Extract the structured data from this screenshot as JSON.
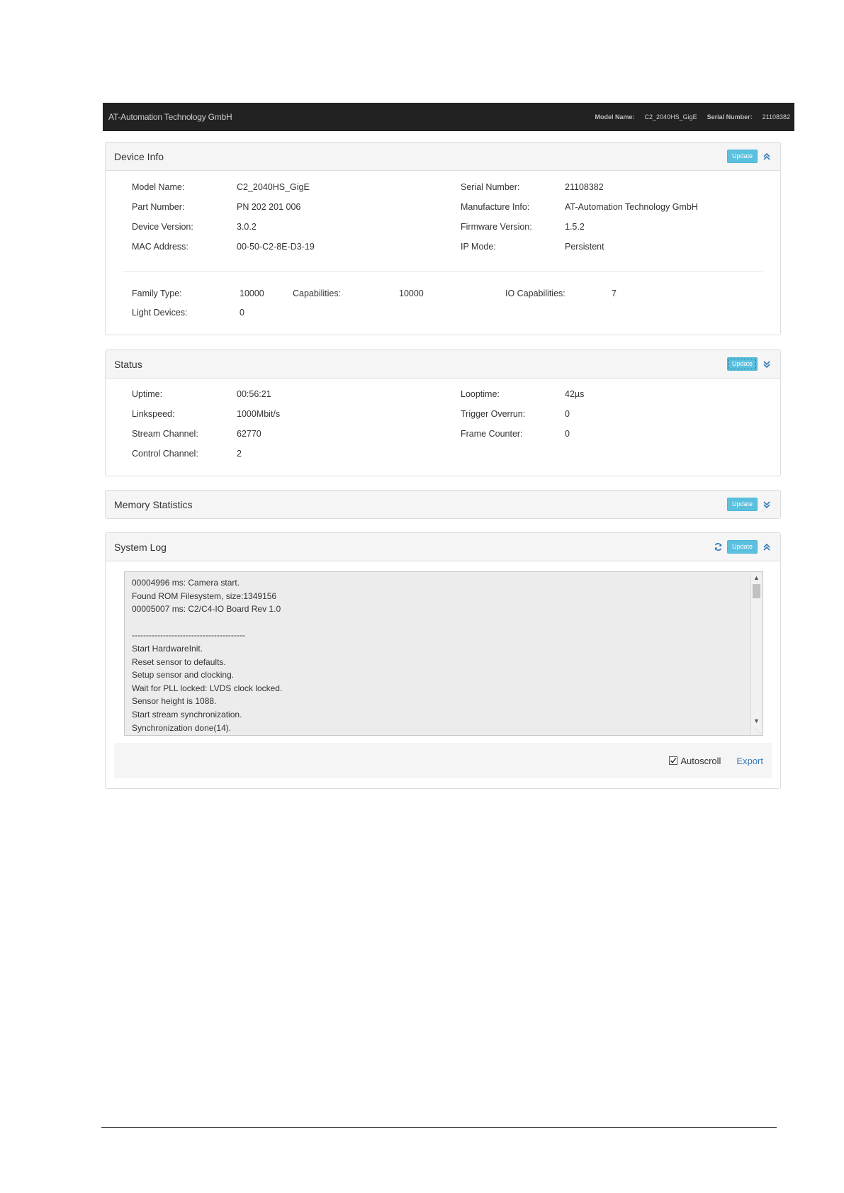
{
  "topbar": {
    "brand": "AT-Automation Technology GmbH",
    "model_label": "Model Name:",
    "model_value": "C2_2040HS_GigE",
    "serial_label": "Serial Number:",
    "serial_value": "21108382"
  },
  "buttons": {
    "update_label": "Update"
  },
  "device_info": {
    "title": "Device Info",
    "left": [
      {
        "label": "Model Name:",
        "value": "C2_2040HS_GigE"
      },
      {
        "label": "Part Number:",
        "value": "PN 202 201 006"
      },
      {
        "label": "Device Version:",
        "value": "3.0.2"
      },
      {
        "label": "MAC Address:",
        "value": "00-50-C2-8E-D3-19"
      }
    ],
    "right": [
      {
        "label": "Serial Number:",
        "value": "21108382"
      },
      {
        "label": "Manufacture Info:",
        "value": "AT-Automation Technology GmbH"
      },
      {
        "label": "Firmware Version:",
        "value": "1.5.2"
      },
      {
        "label": "IP Mode:",
        "value": "Persistent"
      }
    ],
    "family_type_label": "Family Type:",
    "family_type_value": "10000",
    "capabilities_label": "Capabilities:",
    "capabilities_value": "10000",
    "io_capabilities_label": "IO Capabilities:",
    "io_capabilities_value": "7",
    "light_devices_label": "Light Devices:",
    "light_devices_value": "0"
  },
  "status": {
    "title": "Status",
    "left": [
      {
        "label": "Uptime:",
        "value": "00:56:21"
      },
      {
        "label": "Linkspeed:",
        "value": "1000Mbit/s"
      },
      {
        "label": "Stream Channel:",
        "value": "62770"
      },
      {
        "label": "Control Channel:",
        "value": "2"
      }
    ],
    "right": [
      {
        "label": "Looptime:",
        "value": "42µs"
      },
      {
        "label": "Trigger Overrun:",
        "value": "0"
      },
      {
        "label": "Frame Counter:",
        "value": "0"
      }
    ]
  },
  "memory": {
    "title": "Memory Statistics"
  },
  "system_log": {
    "title": "System Log",
    "lines": [
      "00004996 ms: Camera start.",
      "Found ROM Filesystem, size:1349156",
      "00005007 ms: C2/C4-IO Board Rev 1.0",
      "",
      "----------------------------------------",
      "Start HardwareInit.",
      "Reset sensor to defaults.",
      "Setup sensor and clocking.",
      "Wait for PLL locked: LVDS clock locked.",
      "Sensor height is 1088.",
      "Start stream synchronization.",
      "Synchronization done(14)."
    ],
    "autoscroll_label": "Autoscroll",
    "autoscroll_checked": true,
    "export_label": "Export"
  }
}
